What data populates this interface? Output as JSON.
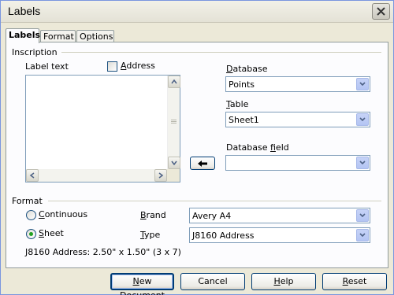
{
  "window": {
    "title": "Labels"
  },
  "tabs": [
    {
      "label": "Labels",
      "active": true
    },
    {
      "label": "Format",
      "active": false
    },
    {
      "label": "Options",
      "active": false
    }
  ],
  "inscription": {
    "group_title": "Inscription",
    "label_text": "Label text",
    "address_label": "Address",
    "address_checked": false,
    "text_value": "",
    "database_label": "Database",
    "database_value": "Points",
    "table_label": "Table",
    "table_value": "Sheet1",
    "database_field_label": "Database field",
    "database_field_value": ""
  },
  "format": {
    "group_title": "Format",
    "continuous_label": "Continuous",
    "sheet_label": "Sheet",
    "selected": "Sheet",
    "brand_label": "Brand",
    "brand_value": "Avery A4",
    "type_label": "Type",
    "type_value": "J8160 Address",
    "info": "J8160 Address: 2.50\" x 1.50\" (3 x 7)"
  },
  "buttons": {
    "new_document": "New Document",
    "cancel": "Cancel",
    "help": "Help",
    "reset": "Reset"
  },
  "icons": [
    "close-icon",
    "scroll-up-icon",
    "scroll-down-icon",
    "scroll-left-icon",
    "scroll-right-icon",
    "dropdown-arrow-icon",
    "insert-arrow-icon"
  ],
  "colors": {
    "dialog_bg": "#ece9d8",
    "panel_bg": "#fcfcfe",
    "radio_dot": "#21a121",
    "button_border": "#003c74"
  }
}
